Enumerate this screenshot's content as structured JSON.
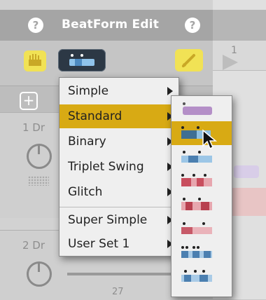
{
  "header": {
    "title": "BeatForm Edit",
    "help_glyph": "?"
  },
  "toolbar": {
    "add_glyph": "+"
  },
  "ruler": {
    "bar_label": "1"
  },
  "tracks": [
    {
      "label": "1 Dr"
    },
    {
      "label": "2 Dr"
    }
  ],
  "track2_partial_value": "27",
  "menu": {
    "items": [
      {
        "label": "Simple"
      },
      {
        "label": "Standard",
        "selected": true
      },
      {
        "label": "Binary"
      },
      {
        "label": "Triplet Swing"
      },
      {
        "label": "Glitch"
      },
      {
        "label": "Super Simple"
      },
      {
        "label": "User Set 1"
      }
    ]
  },
  "submenu": {
    "presets": [
      {
        "icon": "lavender-preset-icon",
        "color": "#b48fc7"
      },
      {
        "icon": "blue-preset-icon",
        "color": "#3f6f93",
        "selected": true
      },
      {
        "icon": "blue-light-preset-icon",
        "color": "#6fa2cc"
      },
      {
        "icon": "red-preset-icon",
        "color": "#c84e5e"
      },
      {
        "icon": "red-preset-icon-2",
        "color": "#b8404f"
      },
      {
        "icon": "red-preset-icon-3",
        "color": "#c75a68"
      },
      {
        "icon": "blue-triplet-preset-icon",
        "color": "#4b7fb0"
      },
      {
        "icon": "blue-triplet-preset-icon-2",
        "color": "#4b7fb0"
      }
    ]
  },
  "colors": {
    "accent_yellow": "#f1e255",
    "selection": "#d8aa14"
  }
}
